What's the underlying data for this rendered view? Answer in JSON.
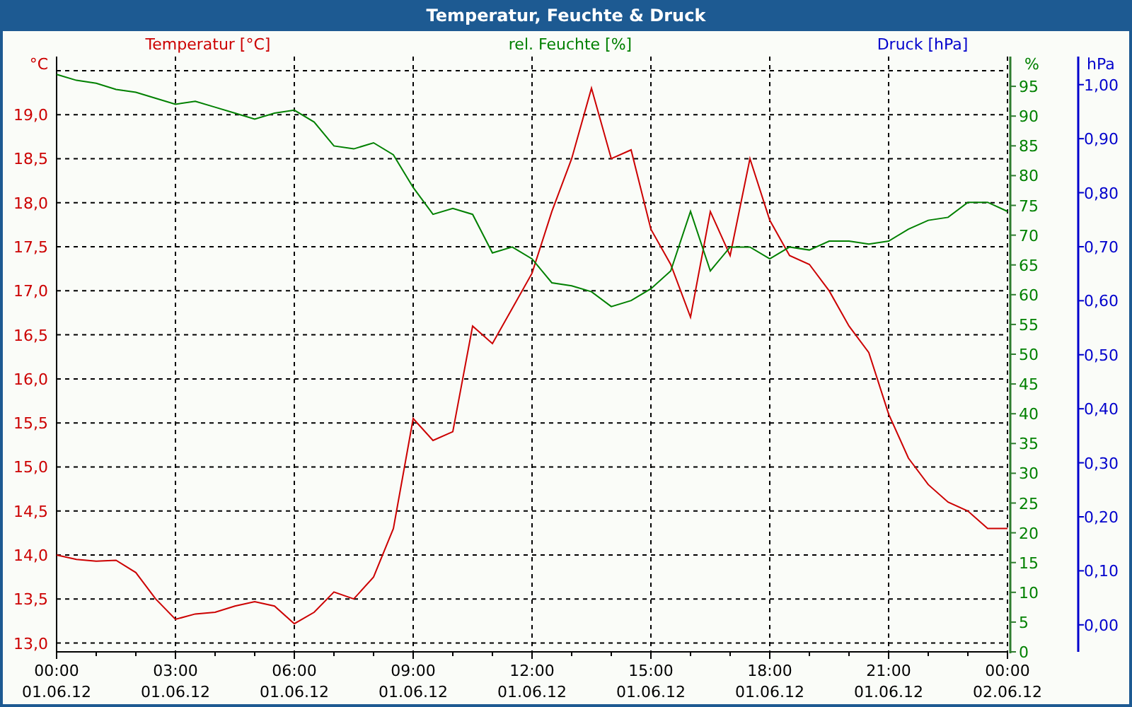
{
  "window": {
    "title": "Temperatur, Feuchte & Druck"
  },
  "chart_data": {
    "type": "line",
    "grid": true,
    "xlim": [
      0,
      24
    ],
    "ylabel": "°C",
    "ylim": [
      12.9,
      19.66
    ],
    "y2label": "%",
    "y2lim": [
      0,
      100
    ],
    "y3label": "hPa",
    "y3lim": [
      -0.05,
      1.052
    ],
    "x": [
      0,
      0.5,
      1,
      1.5,
      2,
      2.5,
      3,
      3.5,
      4,
      4.5,
      5,
      5.5,
      6,
      6.5,
      7,
      7.5,
      8,
      8.5,
      9,
      9.5,
      10,
      10.5,
      11,
      11.5,
      12,
      12.5,
      13,
      13.5,
      14,
      14.5,
      15,
      15.5,
      16,
      16.5,
      17,
      17.5,
      18,
      18.5,
      19,
      19.5,
      20,
      20.5,
      21,
      21.5,
      22,
      22.5,
      23,
      23.5,
      24
    ],
    "xticks": [
      {
        "value": 0,
        "label": "00:00"
      },
      {
        "value": 3,
        "label": "03:00"
      },
      {
        "value": 6,
        "label": "06:00"
      },
      {
        "value": 9,
        "label": "09:00"
      },
      {
        "value": 12,
        "label": "12:00"
      },
      {
        "value": 15,
        "label": "15:00"
      },
      {
        "value": 18,
        "label": "18:00"
      },
      {
        "value": 21,
        "label": "21:00"
      },
      {
        "value": 24,
        "label": "00:00"
      }
    ],
    "yticks": [
      {
        "value": 13,
        "label": "13,0"
      },
      {
        "value": 13.5,
        "label": "13,5"
      },
      {
        "value": 14,
        "label": "14,0"
      },
      {
        "value": 14.5,
        "label": "14,5"
      },
      {
        "value": 15,
        "label": "15,0"
      },
      {
        "value": 15.5,
        "label": "15,5"
      },
      {
        "value": 16,
        "label": "16,0"
      },
      {
        "value": 16.5,
        "label": "16,5"
      },
      {
        "value": 17,
        "label": "17,0"
      },
      {
        "value": 17.5,
        "label": "17,5"
      },
      {
        "value": 18,
        "label": "18,0"
      },
      {
        "value": 18.5,
        "label": "18,5"
      },
      {
        "value": 19,
        "label": "19,0"
      }
    ],
    "y2ticks": [
      0,
      5,
      10,
      15,
      20,
      25,
      30,
      35,
      40,
      45,
      50,
      55,
      60,
      65,
      70,
      75,
      80,
      85,
      90,
      95
    ],
    "y3ticks": [
      {
        "value": 0,
        "label": "0,00"
      },
      {
        "value": 0.1,
        "label": "0,10"
      },
      {
        "value": 0.2,
        "label": "0,20"
      },
      {
        "value": 0.3,
        "label": "0,30"
      },
      {
        "value": 0.4,
        "label": "0,40"
      },
      {
        "value": 0.5,
        "label": "0,50"
      },
      {
        "value": 0.6,
        "label": "0,60"
      },
      {
        "value": 0.7,
        "label": "0,70"
      },
      {
        "value": 0.8,
        "label": "0,80"
      },
      {
        "value": 0.9,
        "label": "0,90"
      },
      {
        "value": 1,
        "label": "1,00"
      }
    ],
    "series": [
      {
        "name": "Temperatur [°C]",
        "color": "#cc0000",
        "values": [
          14.0,
          13.95,
          13.93,
          13.94,
          13.8,
          13.5,
          13.27,
          13.33,
          13.35,
          13.42,
          13.47,
          13.42,
          13.22,
          13.35,
          13.58,
          13.5,
          13.75,
          14.3,
          15.55,
          15.3,
          15.4,
          16.6,
          16.4,
          16.8,
          17.2,
          17.9,
          18.5,
          19.3,
          18.5,
          18.6,
          17.7,
          17.3,
          16.7,
          17.9,
          17.4,
          18.5,
          17.8,
          17.4,
          17.3,
          17.0,
          16.6,
          16.3,
          15.6,
          15.1,
          14.8,
          14.6,
          14.5,
          14.3,
          14.3
        ]
      },
      {
        "name": "rel. Feuchte [%]",
        "color": "#008000",
        "axis": "y2",
        "values": [
          97,
          96,
          95.5,
          94.5,
          94,
          93,
          92,
          92.5,
          91.5,
          90.5,
          89.5,
          90.5,
          91,
          89,
          85,
          84.5,
          85.5,
          83.5,
          78,
          73.5,
          74.5,
          73.5,
          67,
          68,
          66,
          62,
          61.5,
          60.5,
          58,
          59,
          61,
          64,
          74,
          64,
          68,
          68,
          66,
          68,
          67.5,
          69,
          69,
          68.5,
          69,
          71,
          72.5,
          73,
          75.5,
          75.5,
          74
        ]
      }
    ]
  },
  "x_date_labels": [
    "01.06.12",
    "01.06.12",
    "01.06.12",
    "01.06.12",
    "01.06.12",
    "01.06.12",
    "01.06.12",
    "01.06.12",
    "02.06.12"
  ],
  "pressure_legend": "Druck [hPa]"
}
